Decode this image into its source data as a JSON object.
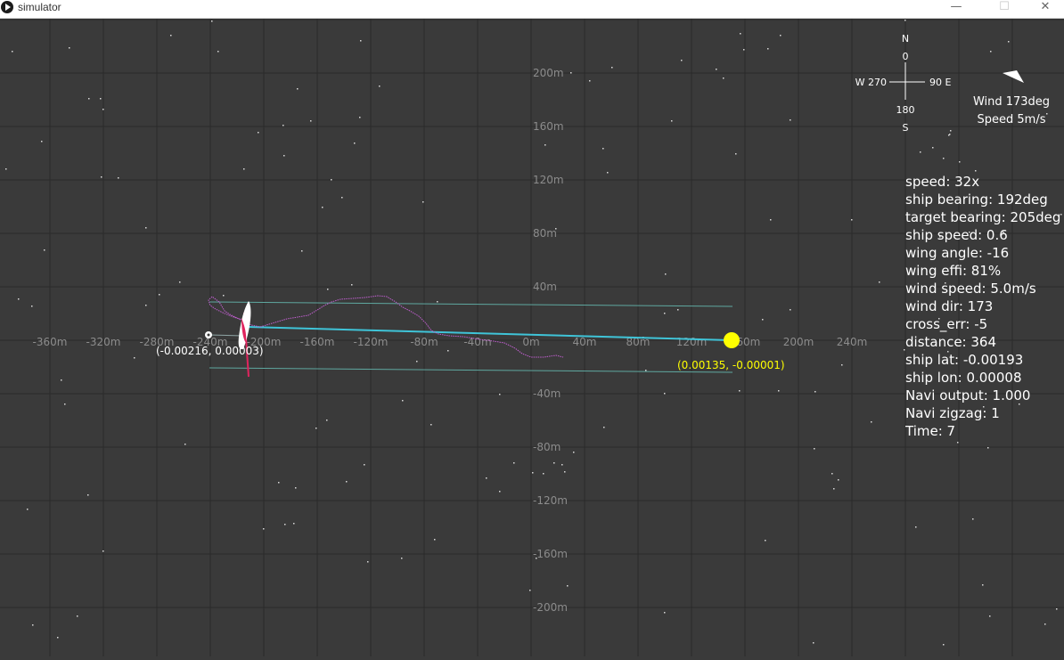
{
  "window": {
    "title": "simulator",
    "minimize_glyph": "—",
    "maximize_glyph": "☐",
    "close_glyph": "✕"
  },
  "map": {
    "x_tick_labels": [
      "-360m",
      "-320m",
      "-280m",
      "-240m",
      "-200m",
      "-160m",
      "-120m",
      "-80m",
      "-40m",
      "0m",
      "40m",
      "80m",
      "120m",
      "160m",
      "200m",
      "240m"
    ],
    "y_tick_labels": [
      "200m",
      "160m",
      "120m",
      "80m",
      "40m",
      "-40m",
      "-80m",
      "-120m",
      "-160m",
      "-200m"
    ],
    "ship_coords": "(-0.00216, 0.00003)",
    "target_coords": "(0.00135, -0.00001)",
    "colors": {
      "background": "#3a3a3a",
      "grid": "#2a2a2a",
      "track": "#c05fcf",
      "route": "#3fc4d8",
      "corridor": "#5fa8a0",
      "target": "#ffff00",
      "ship": "#ffffff",
      "rudder": "#e0245e"
    }
  },
  "compass": {
    "north": "N",
    "north_deg": "0",
    "east": "90 E",
    "west": "W 270",
    "south_deg": "180",
    "south": "S"
  },
  "wind": {
    "direction": "Wind 173deg",
    "speed": "Speed 5m/s",
    "icon": "wind-arrow-icon"
  },
  "info": {
    "speed": "speed: 32x",
    "ship_bearing": "ship bearing: 192deg",
    "target_bearing": "target bearing: 205deg",
    "ship_speed": "ship speed: 0.6",
    "wing_angle": "wing angle: -16",
    "wing_effi": "wing effi: 81%",
    "wind_speed": "wind speed: 5.0m/s",
    "wind_dir": "wind dir: 173",
    "cross_err": "cross_err: -5",
    "distance": "distance: 364",
    "ship_lat": "ship lat: -0.00193",
    "ship_lon": "ship lon: 0.00008",
    "navi_output": "Navi output: 1.000",
    "navi_zigzag": "Navi zigzag: 1",
    "time": "Time: 7"
  }
}
